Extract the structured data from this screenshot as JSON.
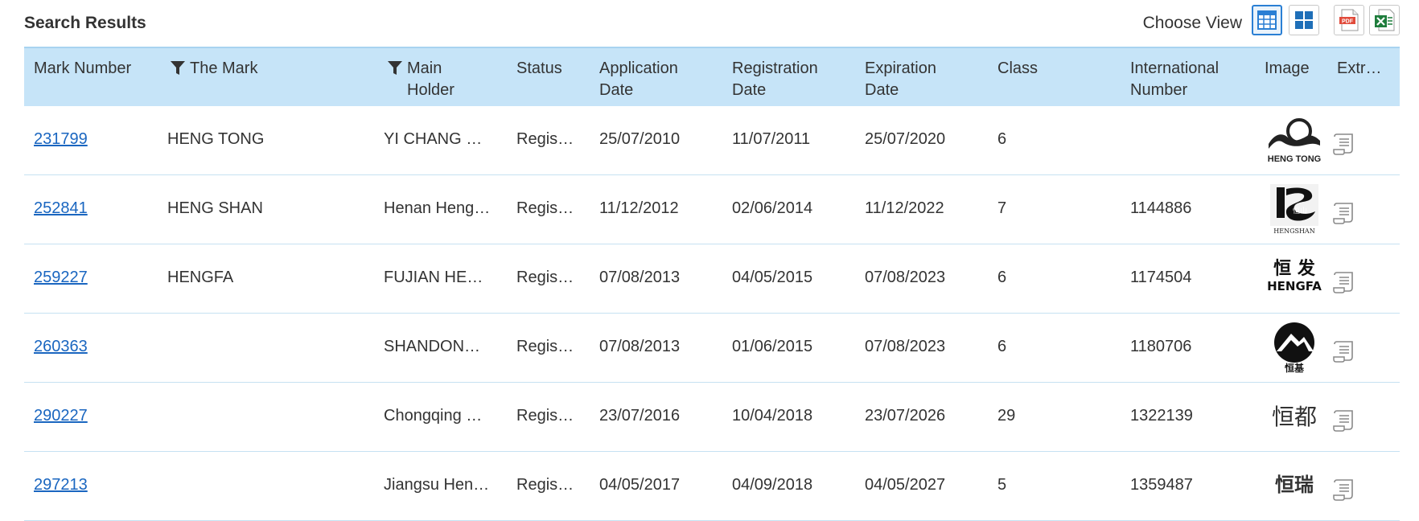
{
  "header": {
    "title": "Search Results",
    "choose_view_label": "Choose View"
  },
  "colors": {
    "header_bg": "#c6e4f8",
    "link": "#1a66c0",
    "active_view": "#2a7fd4",
    "pdf_red": "#e14b3b",
    "excel_green": "#1e7d3c"
  },
  "columns": [
    {
      "key": "mark_number",
      "label": "Mark Number",
      "filter": false
    },
    {
      "key": "the_mark",
      "label": "The Mark",
      "filter": true
    },
    {
      "key": "main_holder",
      "label_line1": "Main",
      "label_line2": "Holder",
      "filter": true
    },
    {
      "key": "status",
      "label": "Status",
      "filter": false
    },
    {
      "key": "application_date",
      "label_line1": "Application",
      "label_line2": "Date",
      "filter": false
    },
    {
      "key": "registration_date",
      "label_line1": "Registration",
      "label_line2": "Date",
      "filter": false
    },
    {
      "key": "expiration_date",
      "label_line1": "Expiration",
      "label_line2": "Date",
      "filter": false
    },
    {
      "key": "class",
      "label": "Class",
      "filter": false
    },
    {
      "key": "international_number",
      "label_line1": "International",
      "label_line2": "Number",
      "filter": false
    },
    {
      "key": "image",
      "label": "Image",
      "filter": false
    },
    {
      "key": "extract",
      "label": "Extr…",
      "filter": false
    }
  ],
  "rows": [
    {
      "mark_number": "231799",
      "the_mark": "HENG TONG",
      "main_holder": "YI CHANG …",
      "status": "Regis…",
      "application_date": "25/07/2010",
      "registration_date": "11/07/2011",
      "expiration_date": "25/07/2020",
      "class": "6",
      "international_number": "",
      "image_text": "HENG TONG"
    },
    {
      "mark_number": "252841",
      "the_mark": "HENG SHAN",
      "main_holder": "Henan Heng…",
      "status": "Regis…",
      "application_date": "11/12/2012",
      "registration_date": "02/06/2014",
      "expiration_date": "11/12/2022",
      "class": "7",
      "international_number": "1144886",
      "image_text": "HENGSHAN"
    },
    {
      "mark_number": "259227",
      "the_mark": "HENGFA",
      "main_holder": "FUJIAN HE…",
      "status": "Regis…",
      "application_date": "07/08/2013",
      "registration_date": "04/05/2015",
      "expiration_date": "07/08/2023",
      "class": "6",
      "international_number": "1174504",
      "image_text": "HENGFA",
      "image_cjk": "恒 发"
    },
    {
      "mark_number": "260363",
      "the_mark": "",
      "main_holder": "SHANDON…",
      "status": "Regis…",
      "application_date": "07/08/2013",
      "registration_date": "01/06/2015",
      "expiration_date": "07/08/2023",
      "class": "6",
      "international_number": "1180706",
      "image_cjk": "恒基"
    },
    {
      "mark_number": "290227",
      "the_mark": "",
      "main_holder": "Chongqing …",
      "status": "Regis…",
      "application_date": "23/07/2016",
      "registration_date": "10/04/2018",
      "expiration_date": "23/07/2026",
      "class": "29",
      "international_number": "1322139",
      "image_cjk": "恒都"
    },
    {
      "mark_number": "297213",
      "the_mark": "",
      "main_holder": "Jiangsu Hen…",
      "status": "Regis…",
      "application_date": "04/05/2017",
      "registration_date": "04/09/2018",
      "expiration_date": "04/05/2027",
      "class": "5",
      "international_number": "1359487",
      "image_cjk": "恒瑞"
    }
  ]
}
